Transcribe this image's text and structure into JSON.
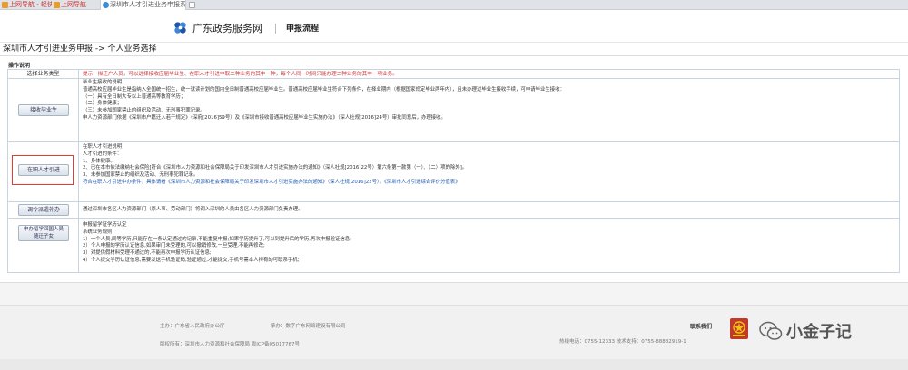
{
  "browser": {
    "tabs": [
      {
        "label": "上网导航 - 轻快上网 从这里开..."
      },
      {
        "label": "上网导航"
      },
      {
        "label": "深圳市人才引进业务申报系统 ×"
      },
      {
        "label": ""
      }
    ]
  },
  "header": {
    "brand": "广东政务服务网",
    "process": "申报流程"
  },
  "breadcrumb": "深圳市人才引进业务申报 -> 个人业务选择",
  "section_title": "操作说明",
  "table": {
    "header": {
      "left": "选择业务类型",
      "right": "提示：拟迁户人员，可以选择接收应届毕业生、在职人才引进中取二种业务的其中一种，每个人同一时间只能办理二种业务的其中一项业务。"
    },
    "rows": [
      {
        "button": "接收毕业生",
        "lines": [
          "毕业生接收的说明：",
          "      普通高校应届毕业生是指纳入全国统一招生，统一就读计划的国内全日制普通高校应届毕业生。普通高校应届毕业生符合下列条件，在择业期内（根据国家规定毕业两年内），且未办理过毕业生接收手续，可申请毕业生接收：",
          "（一）具有全日制大专以上普通高等教育学历；",
          "（二）身体健康；",
          "（三）未参加国家禁止的组织及活动、无刑事犯罪记录。",
          "  申人力资源部门依据《深圳市户籍迁入若干规定》（深府[2016]59号）及《深圳市接收普通高校应届毕业生实施办法》（深人社规[2016]24号）审批同意后，办理接收。"
        ]
      },
      {
        "button": "在职人才引进",
        "lines": [
          "在职人才引进说明：",
          "人才引进的条件：",
          "1、身体健康。",
          "2、已在本市依法缴纳社会保险[符合《深圳市人力资源和社会保障局关于印发深圳市人才引进实施办法的通知》（深人社规[2016]22号）第六条第一款第（一）、（二）项的除外]。",
          "3、未参加国家禁止的组织及活动、无刑事犯罪记录。",
          "符合在职人才引进中办条件，具体请看《深圳市人力资源和社会保障局关于印发深圳市人才引进实施办法的通知》（深人社规[2016]22号），《深圳市人才引进综合评价分值表》"
        ]
      },
      {
        "button": "调令派遣补办",
        "lines": [
          "通过深圳市各区人力资源部门（原人事、劳动部门）将调入深圳的人员由各区人力资源部门负责办理。"
        ]
      },
      {
        "button": "申办留学回国人员随迁子女",
        "lines": [
          "申报留学证学历认定",
          "系统业务规则",
          "  1）一个人员,同等学历,只能存在一条认定通过的记录,不能重复申报;如果学历提升了,可以到提升后的学历,再次申报验证信息;",
          "  2）个人申报的学历认证信息,如果审门未受理的,可以撤销修改,一旦受理,不能再修改;",
          "  3）对提供假材料受理不通过的,不能再次申报学历认证信息;",
          "  4）个人提交学历认证信息,需要发送手机验证码,验证通过,才能提交,手机号需本人持有的可联系手机;"
        ]
      }
    ]
  },
  "footer": {
    "host": "主办：广东省人民政府办公厅",
    "support": "承办：数字广东网络建设有限公司",
    "copyright": "版权所有：深圳市人力资源和社会保障局  粤ICP备05017767号",
    "contact": "联系我们",
    "hotline": "热线电话：0755-12333  技术支持：0755-88882919-1"
  },
  "watermark": {
    "icon": "wechat-icon",
    "text": "小金子记"
  },
  "colors": {
    "accent_blue": "#1f56a8",
    "highlight_red": "#e53935"
  }
}
